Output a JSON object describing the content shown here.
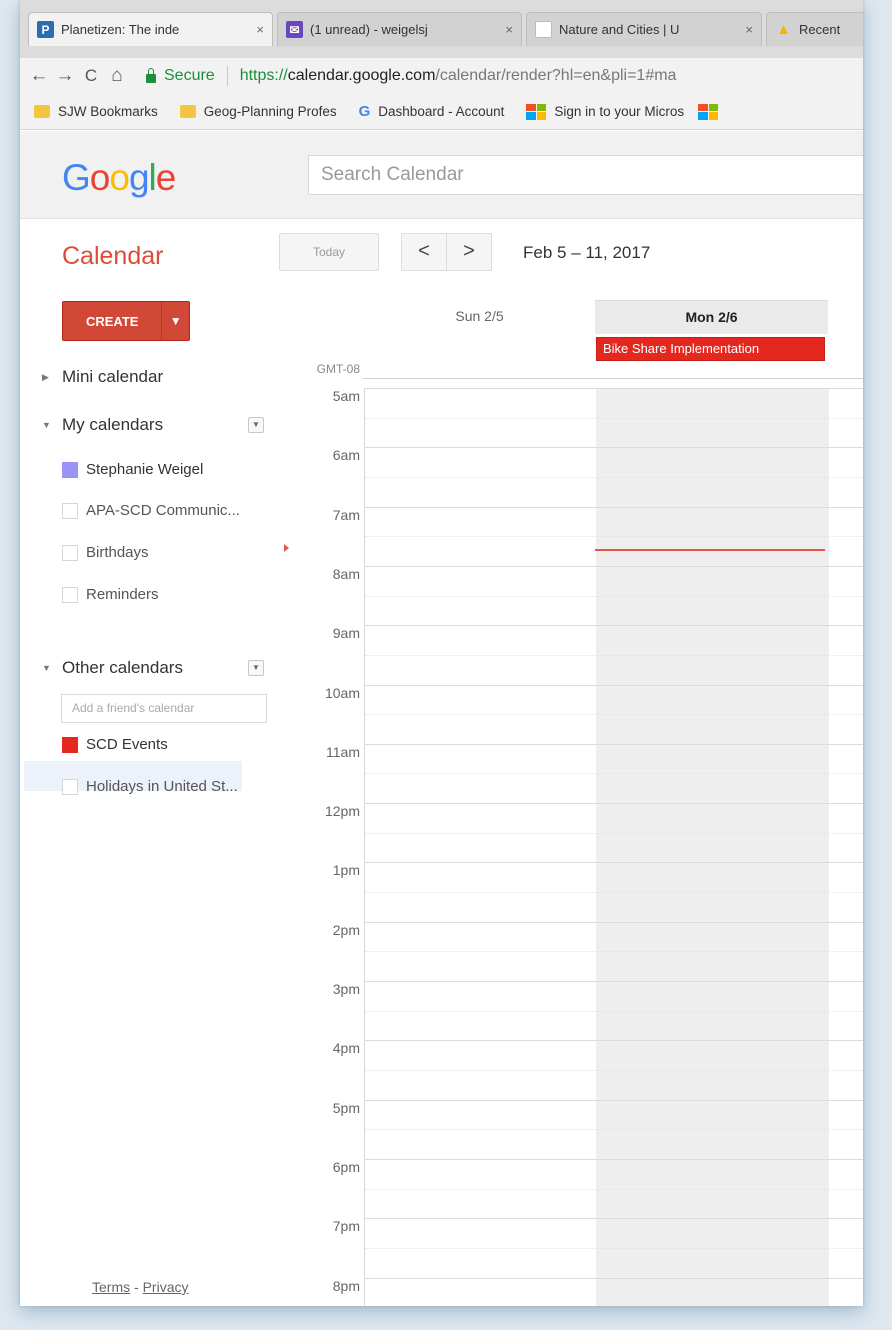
{
  "browser": {
    "tabs": [
      {
        "title": "Planetizen: The inde",
        "favicon": "planetizen-icon",
        "color": "#2a6db0",
        "glyph": "P"
      },
      {
        "title": "(1 unread) - weigelsj",
        "favicon": "mail-icon",
        "color": "#6b46c1",
        "glyph": "✉"
      },
      {
        "title": "Nature and Cities | U",
        "favicon": "page-icon",
        "color": "#ffffff",
        "glyph": ""
      },
      {
        "title": "Recent",
        "favicon": "drive-icon",
        "color": "#f4b400",
        "glyph": "▲"
      }
    ],
    "close_glyph": "×",
    "nav": {
      "back": "←",
      "forward": "→",
      "reload": "C",
      "home": "⌂"
    },
    "secure_label": "Secure",
    "url_scheme": "https://",
    "url_host": "calendar.google.com",
    "url_path": "/calendar/render?hl=en&pli=1#ma",
    "bookmarks": [
      {
        "label": "SJW Bookmarks",
        "icon": "folder-icon"
      },
      {
        "label": "Geog-Planning Profes",
        "icon": "folder-icon"
      },
      {
        "label": "Dashboard - Account",
        "icon": "google-icon"
      },
      {
        "label": "Sign in to your Micros",
        "icon": "microsoft-icon"
      }
    ]
  },
  "header": {
    "logo_letters": [
      {
        "ch": "G",
        "color": "#4285f4"
      },
      {
        "ch": "o",
        "color": "#ea4335"
      },
      {
        "ch": "o",
        "color": "#fbbc05"
      },
      {
        "ch": "g",
        "color": "#4285f4"
      },
      {
        "ch": "l",
        "color": "#34a853"
      },
      {
        "ch": "e",
        "color": "#ea4335"
      }
    ],
    "search_placeholder": "Search Calendar"
  },
  "toolbar": {
    "title": "Calendar",
    "today_label": "Today",
    "prev_glyph": "<",
    "next_glyph": ">",
    "date_range": "Feb 5 – 11, 2017"
  },
  "sidebar": {
    "create_label": "CREATE",
    "create_caret": "▼",
    "mini_calendar": "Mini calendar",
    "my_calendars": {
      "title": "My calendars",
      "items": [
        {
          "label": "Stephanie Weigel",
          "color": "#9b93f5",
          "checked": true
        },
        {
          "label": "APA-SCD Communic...",
          "color": "",
          "checked": false
        },
        {
          "label": "Birthdays",
          "color": "",
          "checked": false
        },
        {
          "label": "Reminders",
          "color": "",
          "checked": false
        }
      ]
    },
    "other_calendars": {
      "title": "Other calendars",
      "add_placeholder": "Add a friend's calendar",
      "items": [
        {
          "label": "SCD Events",
          "color": "#e4281f",
          "checked": true
        },
        {
          "label": "Holidays in United St...",
          "color": "",
          "checked": false
        }
      ]
    },
    "footer": {
      "terms": "Terms",
      "separator": " - ",
      "privacy": "Privacy"
    }
  },
  "week": {
    "days": [
      {
        "label": "Sun 2/5",
        "today": false
      },
      {
        "label": "Mon 2/6",
        "today": true
      }
    ],
    "timezone": "GMT-08",
    "hours": [
      "5am",
      "6am",
      "7am",
      "8am",
      "9am",
      "10am",
      "11am",
      "12pm",
      "1pm",
      "2pm",
      "3pm",
      "4pm",
      "5pm",
      "6pm",
      "7pm",
      "8pm"
    ],
    "allday_event": {
      "title": "Bike Share Implementation",
      "day": "Mon 2/6",
      "color": "#e4281f"
    }
  }
}
